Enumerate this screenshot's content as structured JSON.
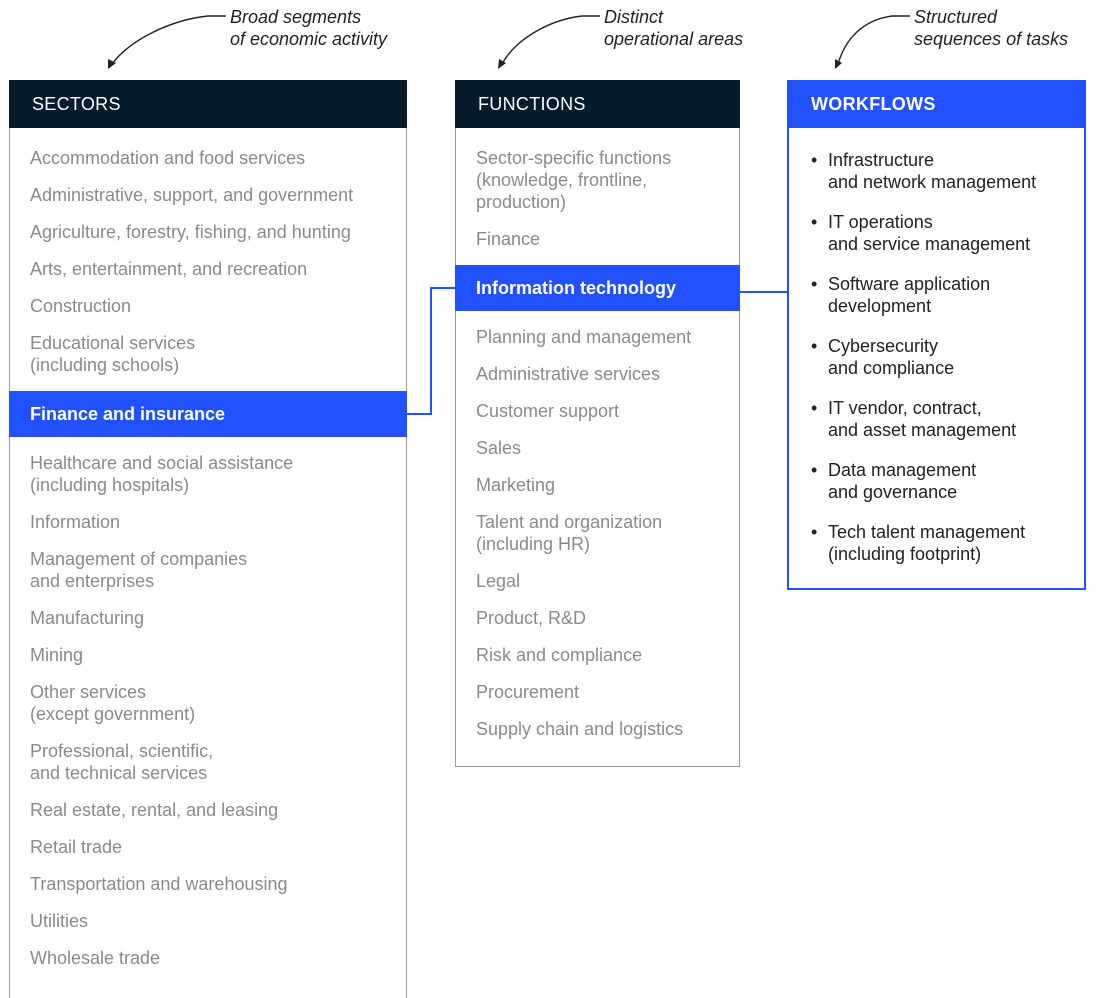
{
  "annotations": {
    "sectors": "Broad segments\nof economic activity",
    "functions": "Distinct\noperational areas",
    "workflows": "Structured\nsequences of tasks"
  },
  "sectors": {
    "header": "SECTORS",
    "items": [
      "Accommodation and food services",
      "Administrative, support, and government",
      "Agriculture, forestry, fishing, and hunting",
      "Arts, entertainment, and recreation",
      "Construction",
      "Educational services\n(including schools)",
      "Finance and insurance",
      "Healthcare and social assistance\n(including hospitals)",
      "Information",
      "Management of companies\nand enterprises",
      "Manufacturing",
      "Mining",
      "Other services\n(except government)",
      "Professional, scientific,\nand technical services",
      "Real estate, rental, and leasing",
      "Retail trade",
      "Transportation and warehousing",
      "Utilities",
      "Wholesale trade"
    ],
    "active": "Finance and insurance"
  },
  "functions": {
    "header": "FUNCTIONS",
    "items": [
      "Sector-specific functions\n(knowledge, frontline,\nproduction)",
      "Finance",
      "Information technology",
      "Planning and management",
      "Administrative services",
      "Customer support",
      "Sales",
      "Marketing",
      "Talent and organization\n(including HR)",
      "Legal",
      "Product, R&D",
      "Risk and compliance",
      "Procurement",
      "Supply chain and logistics"
    ],
    "active": "Information technology"
  },
  "workflows": {
    "header": "WORKFLOWS",
    "items": [
      "Infrastructure\nand network management",
      "IT operations\nand service management",
      "Software application\ndevelopment",
      "Cybersecurity\nand compliance",
      "IT vendor, contract,\nand asset management",
      "Data management\nand governance",
      "Tech talent management\n(including footprint)"
    ]
  },
  "colors": {
    "accent": "#2251ff",
    "header_dark": "#051c2c",
    "muted_text": "#8a8a8a"
  }
}
